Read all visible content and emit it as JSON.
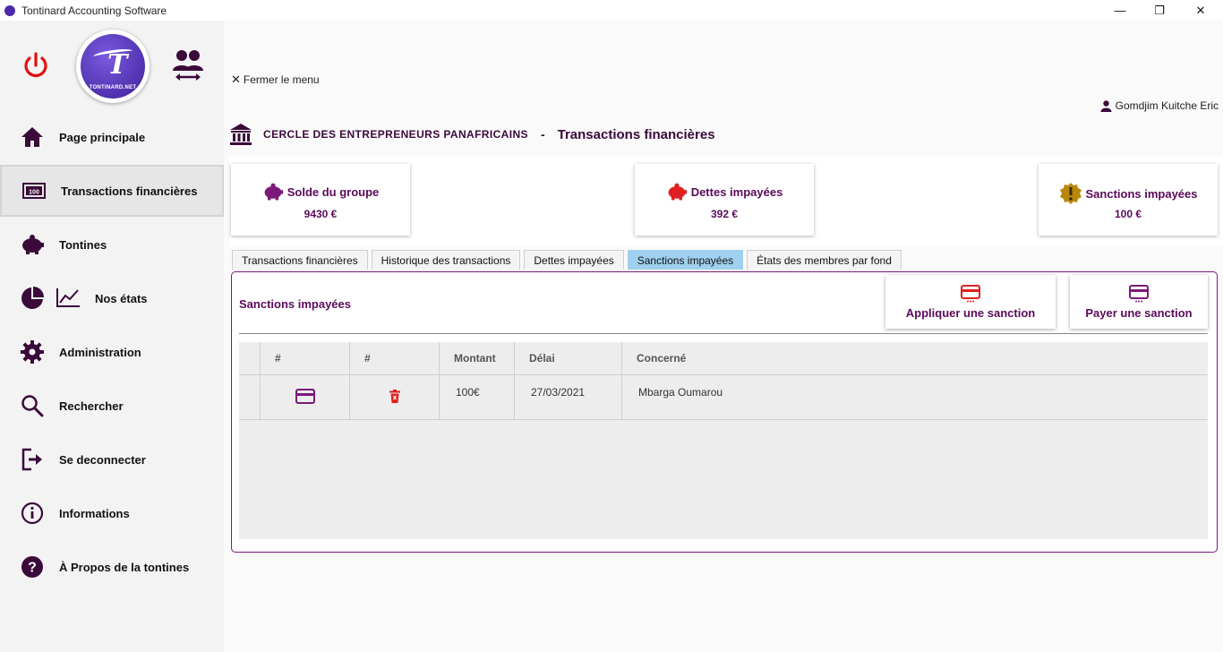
{
  "window": {
    "title": "Tontinard Accounting Software",
    "controls": [
      "minimize",
      "restore",
      "close"
    ]
  },
  "sidebar": {
    "logo_text": "TONTINARD.NET",
    "items": [
      {
        "label": "Page principale",
        "icon": "home-icon"
      },
      {
        "label": "Transactions financières",
        "icon": "money-icon",
        "active": true
      },
      {
        "label": "Tontines",
        "icon": "piggy-bank-icon"
      },
      {
        "label": "Nos états",
        "icon": "chart-icon"
      },
      {
        "label": "Administration",
        "icon": "gear-icon"
      },
      {
        "label": "Rechercher",
        "icon": "search-icon"
      },
      {
        "label": "Se deconnecter",
        "icon": "logout-icon"
      },
      {
        "label": "Informations",
        "icon": "info-icon"
      },
      {
        "label": "À Propos de la  tontines",
        "icon": "help-icon"
      }
    ]
  },
  "main": {
    "close_menu": "Fermer le menu",
    "user_name": "Gomdjim Kuitche Eric",
    "org_name": "CERCLE DES ENTREPRENEURS PANAFRICAINS",
    "separator": "-",
    "page_title": "Transactions financières",
    "cards": [
      {
        "title": "Solde du groupe",
        "value": "9430 €",
        "icon": "piggy-bank-icon",
        "color": "#7a1a7a"
      },
      {
        "title": "Dettes impayées",
        "value": "392 €",
        "icon": "piggy-bank-icon",
        "color": "#e02020"
      },
      {
        "title": "Sanctions impayées",
        "value": "100 €",
        "icon": "warning-badge-icon",
        "color": "#b8860b"
      }
    ],
    "tabs": [
      {
        "label": "Transactions financières"
      },
      {
        "label": "Historique des transactions"
      },
      {
        "label": "Dettes impayées"
      },
      {
        "label": "Sanctions impayées",
        "active": true
      },
      {
        "label": "États des membres par fond"
      }
    ],
    "panel": {
      "title": "Sanctions impayées",
      "apply_button": "Appliquer une sanction",
      "pay_button": "Payer une sanction",
      "columns": [
        "#",
        "#",
        "Montant",
        "Délai",
        "Concerné"
      ],
      "rows": [
        {
          "amount": "100€",
          "deadline": "27/03/2021",
          "member": "Mbarga Oumarou"
        }
      ]
    }
  },
  "colors": {
    "accent_purple": "#5a0a5a",
    "danger_red": "#e02020",
    "active_tab": "#9fd0f0"
  }
}
